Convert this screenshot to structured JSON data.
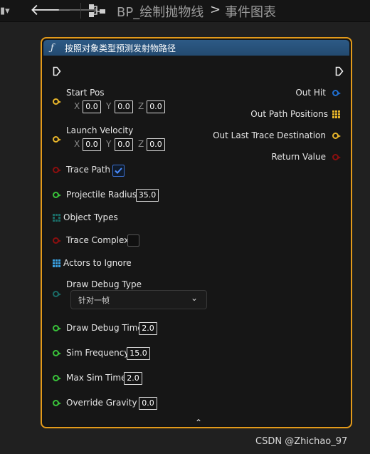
{
  "toolbar": {
    "menu_icon": "menu-icon",
    "back_icon": "back-arrow-icon",
    "forward_icon": "forward-arrow-icon",
    "graph_icon": "graph-icon",
    "breadcrumb_1": "BP_绘制抛物线",
    "breadcrumb_sep": ">",
    "breadcrumb_2": "事件图表"
  },
  "node": {
    "icon": "function-icon",
    "icon_glyph": "ƒ",
    "title": "按照对象类型预测发射物路径",
    "accent_color": "#e39a1a",
    "header_color": "#2d5a86",
    "inputs": {
      "start_pos": {
        "label": "Start Pos",
        "x": "0.0",
        "y": "0.0",
        "z": "0.0"
      },
      "launch_velocity": {
        "label": "Launch Velocity",
        "x": "0.0",
        "y": "0.0",
        "z": "0.0"
      },
      "trace_path": {
        "label": "Trace Path",
        "checked": true
      },
      "projectile_radius": {
        "label": "Projectile Radius",
        "value": "35.0"
      },
      "object_types": {
        "label": "Object Types"
      },
      "trace_complex": {
        "label": "Trace Complex",
        "checked": false
      },
      "actors_to_ignore": {
        "label": "Actors to Ignore"
      },
      "draw_debug_type": {
        "label": "Draw Debug Type",
        "selected": "针对一帧"
      },
      "draw_debug_time": {
        "label": "Draw Debug Time",
        "value": "2.0"
      },
      "sim_frequency": {
        "label": "Sim Frequency",
        "value": "15.0"
      },
      "max_sim_time": {
        "label": "Max Sim Time",
        "value": "2.0"
      },
      "override_gravity_z": {
        "label": "Override Gravity Z",
        "value": "0.0"
      }
    },
    "axis_labels": {
      "x": "X",
      "y": "Y",
      "z": "Z"
    },
    "outputs": {
      "out_hit": "Out Hit",
      "out_path_positions": "Out Path Positions",
      "out_last_trace_destination": "Out Last Trace Destination",
      "return_value": "Return Value"
    },
    "collapse_glyph": "⌃"
  },
  "pin_colors": {
    "vector": "#e8b52a",
    "bool": "#8c0f0f",
    "float": "#39c23a",
    "struct": "#1f6fd1",
    "array": "#3aa0e0",
    "byte": "#1a6b66"
  },
  "watermark": "CSDN @Zhichao_97"
}
